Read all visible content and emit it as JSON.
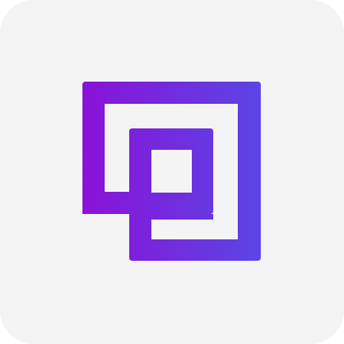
{
  "app_icon": {
    "tile_color": "#f4f4f5",
    "logo": {
      "icon": "interlocked-squares-icon",
      "gradient_start": "#8a12d8",
      "gradient_end": "#5b45e6"
    }
  }
}
